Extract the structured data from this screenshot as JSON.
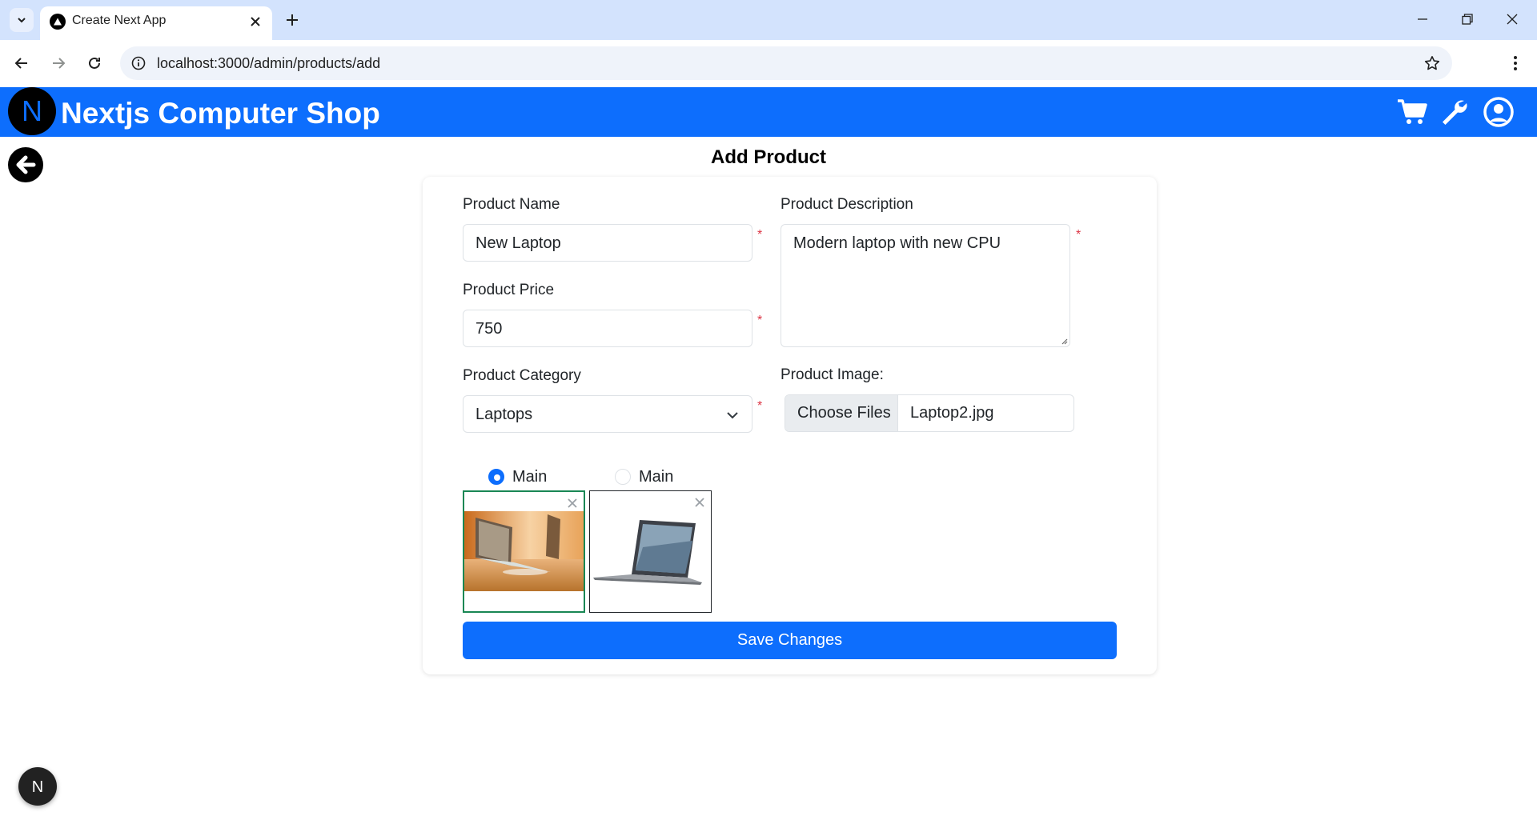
{
  "browser": {
    "tab_title": "Create Next App",
    "url": "localhost:3000/admin/products/add"
  },
  "app": {
    "brand": "Nextjs Computer Shop",
    "logo_letter": "N",
    "nav_icons": [
      "cart-icon",
      "wrench-icon",
      "user-circle-icon"
    ],
    "brand_color": "#0d6efd"
  },
  "page": {
    "title": "Add Product"
  },
  "form": {
    "name": {
      "label": "Product Name",
      "value": "New Laptop"
    },
    "description": {
      "label": "Product Description",
      "value": "Modern laptop with new CPU"
    },
    "price": {
      "label": "Product Price",
      "value": "750"
    },
    "category": {
      "label": "Product Category",
      "value": "Laptops"
    },
    "image": {
      "label": "Product Image:",
      "button": "Choose Files",
      "filename": "Laptop2.jpg"
    },
    "required_mark": "*",
    "images": [
      {
        "radio_label": "Main",
        "selected": true,
        "name": "laptop-on-desk"
      },
      {
        "radio_label": "Main",
        "selected": false,
        "name": "grey-laptop"
      }
    ],
    "save_label": "Save Changes"
  },
  "dev_badge": "N"
}
